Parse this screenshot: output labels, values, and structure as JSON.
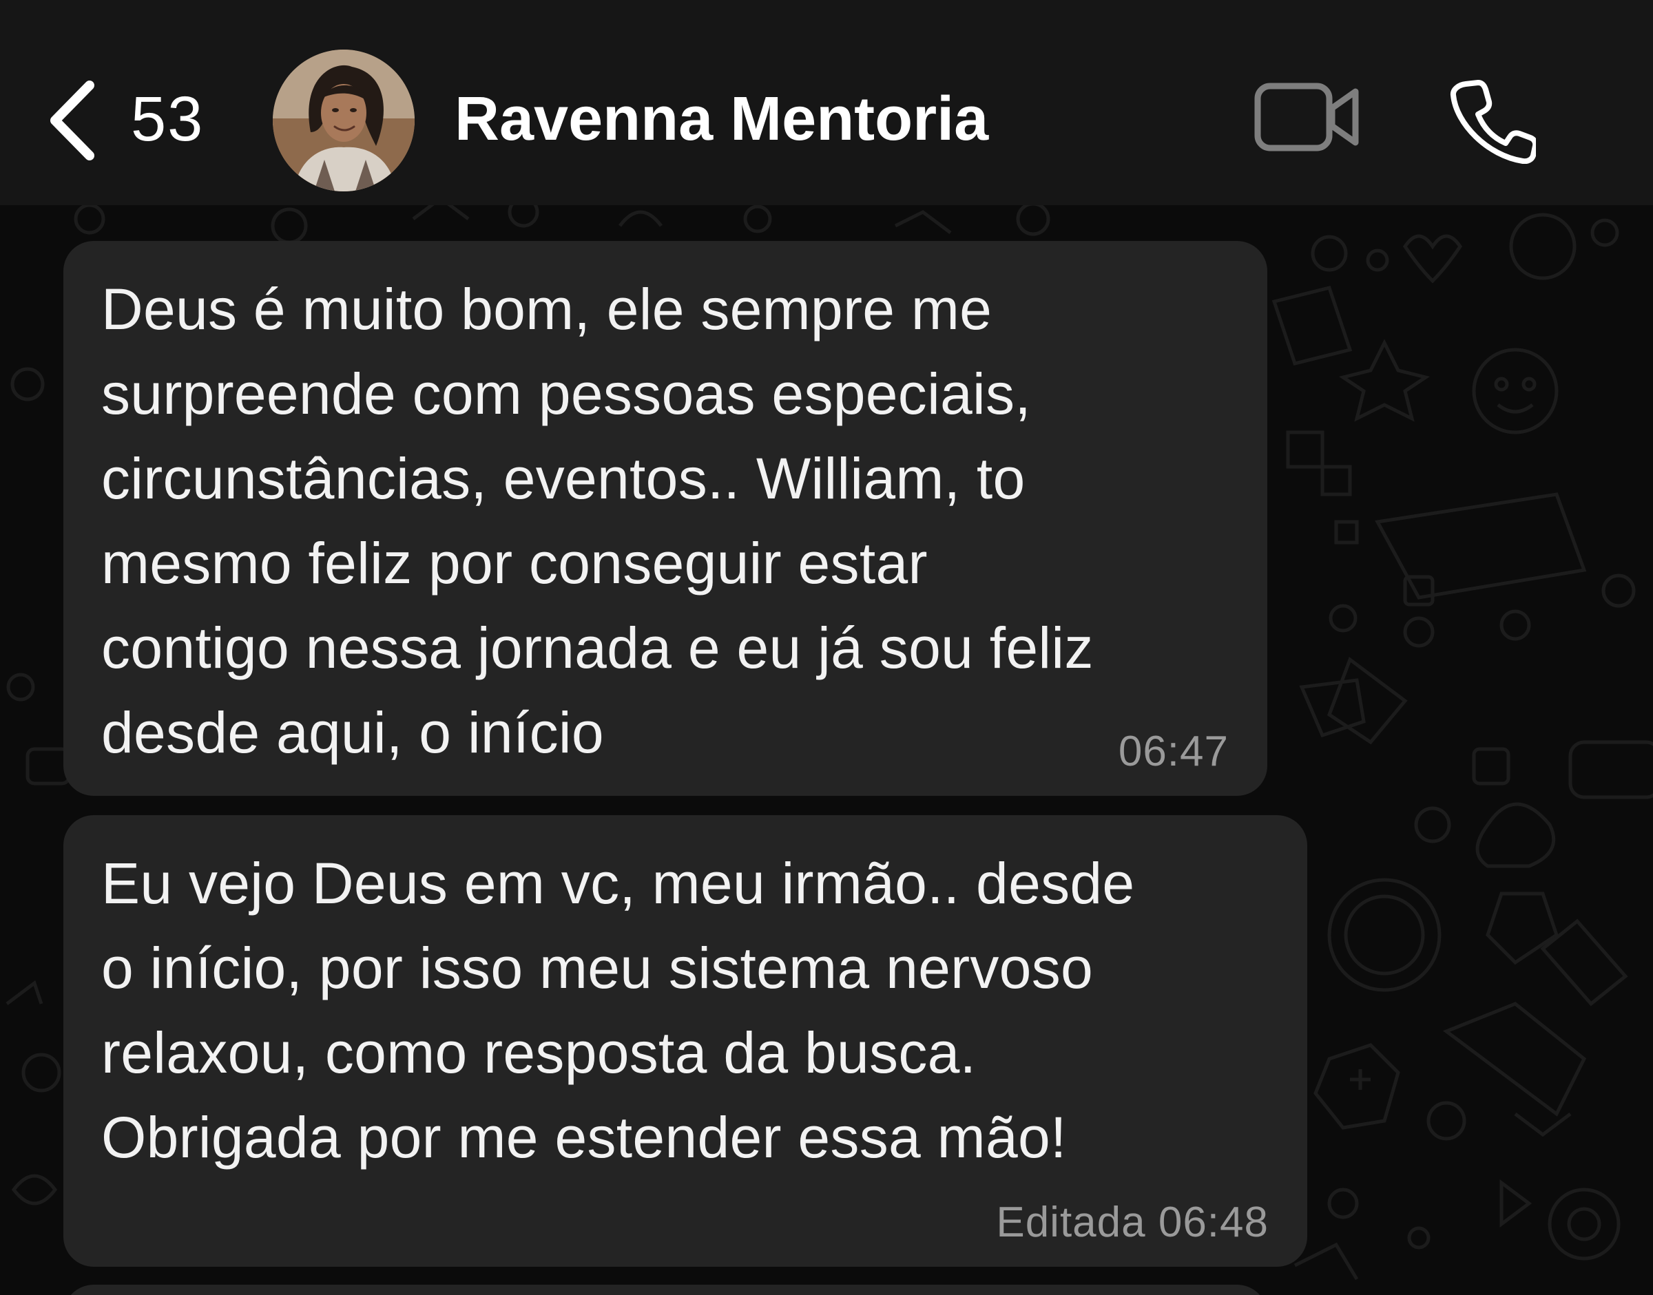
{
  "header": {
    "unread_count": "53",
    "contact_name": "Ravenna Mentoria"
  },
  "messages": [
    {
      "text": "Deus é muito bom, ele sempre me\nsurpreende com pessoas especiais,\ncircunstâncias, eventos.. William, to\nmesmo feliz por conseguir estar\ncontigo nessa jornada e eu já sou feliz\ndesde aqui, o início",
      "time": "06:47"
    },
    {
      "text": "Eu vejo Deus em vc, meu irmão.. desde\no início, por isso meu sistema nervoso\nrelaxou, como resposta da busca.\nObrigada por me estender essa mão!",
      "time": "Editada 06:48"
    }
  ],
  "colors": {
    "header_bg": "#161616",
    "chat_bg": "#0b0b0b",
    "bubble_bg": "#242424",
    "text": "#f2f2f2",
    "meta_text": "#9a9a9a",
    "icon_gray": "#8a8a8a"
  },
  "icons": [
    "back-chevron-icon",
    "video-call-icon",
    "phone-call-icon",
    "contact-avatar"
  ]
}
